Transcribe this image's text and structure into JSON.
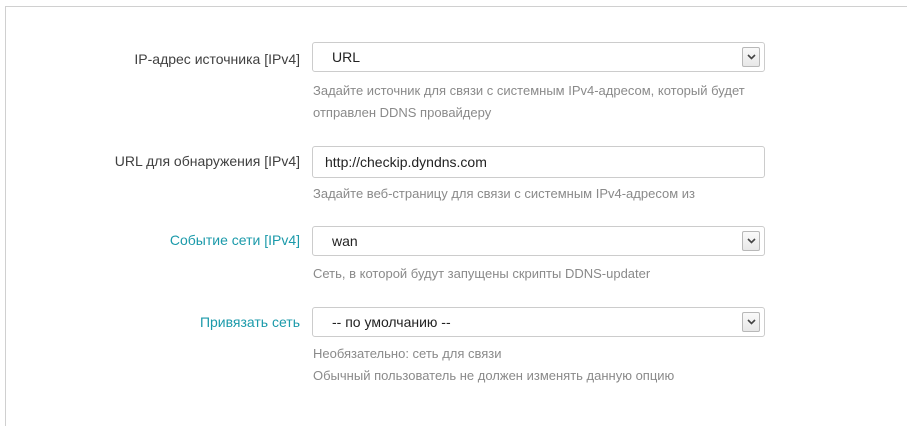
{
  "fields": [
    {
      "label": "IP-адрес источника [IPv4]",
      "value": "URL",
      "help_lines": [
        "Задайте источник для связи с системным IPv4-адресом, который будет",
        "отправлен DDNS провайдеру"
      ]
    },
    {
      "label": "URL для обнаружения [IPv4]",
      "value": "http://checkip.dyndns.com",
      "help_lines": [
        "Задайте веб-страницу для связи с системным IPv4-адресом из"
      ]
    },
    {
      "label": "Событие сети [IPv4]",
      "value": "wan",
      "help_lines": [
        "Сеть, в которой будут запущены скрипты DDNS-updater"
      ]
    },
    {
      "label": "Привязать сеть",
      "value": "-- по умолчанию --",
      "help_lines": [
        "Необязательно: сеть для связи",
        "Обычный пользователь не должен изменять данную опцию"
      ]
    }
  ],
  "colors": {
    "label": "#404040",
    "label_accent": "#1b9aaa",
    "help": "#8a8a8a",
    "border": "#cccccc"
  },
  "icons": {
    "dropdown": "chevron-down-icon"
  }
}
